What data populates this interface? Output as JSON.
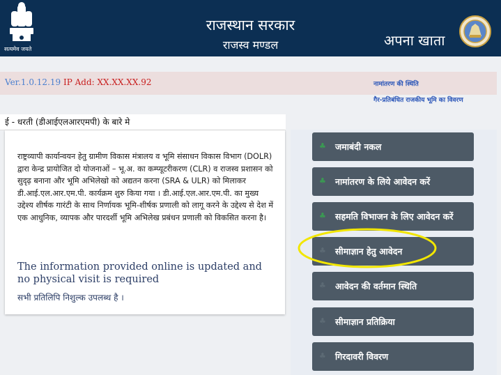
{
  "header": {
    "emblem_caption": "सत्यमेव जयते",
    "title": "राजस्थान सरकार",
    "subtitle": "राजस्व मण्डल",
    "app_name": "अपना खाता"
  },
  "info_bar": {
    "version": "Ver.1.0.12.19",
    "ip": "IP Add: XX.XX.XX.92",
    "links": [
      "नामांतरण की स्थिति",
      "गैर-प्रतिबंधित राजकीय भूमि का विवरण"
    ]
  },
  "about": {
    "heading": "ई - धरती (डीआईएलआरएमपी) के बारे मे",
    "paragraph": "राष्ट्रव्यापी कार्यान्वयन हेतु ग्रामीण विकास मंत्रालय व भूमि संसाधन विकास विभाग (DOLR) द्वारा केन्द्र प्रायोजित दो योजनाओं – भू.अ. का कम्प्यूटरीकरण (CLR) व राजस्व प्रशासन को सुदृढ़ बनाना और भूमि अभिलेखो को अद्यतन करना (SRA & ULR) को मिलाकर डी.आई.एल.आर.एम.पी. कार्यक्रम शुरु किया गया । डी.आई.एल.आर.एम.पी. का मुख्य उद्देश्य शीर्षक गारंटी के साथ निर्णायक भूमि-शीर्षक प्रणाली को लागू करने के उद्देश्य से देश में एक आधुनिक, व्यापक और पारदर्शी भूमि अभिलेख प्रबंधन प्रणाली को विकसित करना है।",
    "english_note": "The information provided online is updated and no physical visit is required",
    "free_note": "सभी प्रतिलिपि निशुल्क उपलब्ध है ।"
  },
  "menu": {
    "items": [
      {
        "label": "जमाबंदी नकल",
        "icon": "♣"
      },
      {
        "label": "नामांतरण के लिये आवेदन करें",
        "icon": "♣"
      },
      {
        "label": "सहमति विभाजन के लिए आवेदन करें",
        "icon": "♣"
      },
      {
        "label": "सीमाज्ञान हेतु आवेदन",
        "icon": "♣"
      },
      {
        "label": "आवेदन की वर्तमान स्थिति",
        "icon": "♣"
      },
      {
        "label": "सीमाज्ञान प्रतिक्रिया",
        "icon": "♣"
      },
      {
        "label": "गिरदावरी विवरण",
        "icon": "♣"
      }
    ]
  },
  "colors": {
    "header_bg": "#0c2f53",
    "button_bg": "#4d5a66",
    "highlight": "#f2e600",
    "icon_green": "#3a9a52"
  }
}
